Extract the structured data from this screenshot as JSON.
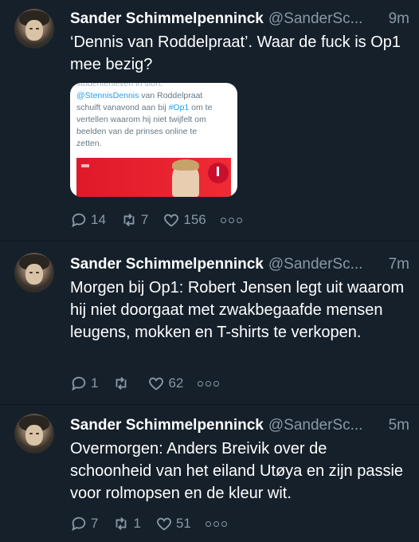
{
  "tweets": [
    {
      "name": "Sander Schimmelpenninck",
      "handle": "@SanderSc...",
      "time": "9m",
      "text": "‘Dennis van Roddelpraat’. Waar de fuck is Op1 mee bezig?",
      "media": {
        "top_cut": "studentenleven in stort.",
        "mention": "@StennisDennis",
        "line1_rest": " van Roddelpraat",
        "line2_pre": "schuift vanavond aan bij ",
        "hashtag": "#Op1",
        "line2_post": " om te",
        "line3": "vertellen waarom hij niet twijfelt om",
        "line4": "beelden van de prinses online te",
        "line5": "zetten."
      },
      "replies": "14",
      "retweets": "7",
      "likes": "156"
    },
    {
      "name": "Sander Schimmelpenninck",
      "handle": "@SanderSc...",
      "time": "7m",
      "text": "Morgen bij Op1: Robert Jensen legt uit waarom hij niet doorgaat met zwakbegaafde mensen leugens, mokken en T-shirts te verkopen.",
      "replies": "1",
      "retweets": "",
      "likes": "62"
    },
    {
      "name": "Sander Schimmelpenninck",
      "handle": "@SanderSc...",
      "time": "5m",
      "text": "Overmorgen: Anders Breivik over de schoonheid van het eiland Utøya en zijn passie voor rolmopsen en de kleur wit.",
      "replies": "7",
      "retweets": "1",
      "likes": "51"
    }
  ],
  "colors": {
    "background": "#15202b",
    "muted": "#8899a6",
    "text": "#ffffff",
    "link": "#1da1f2"
  }
}
